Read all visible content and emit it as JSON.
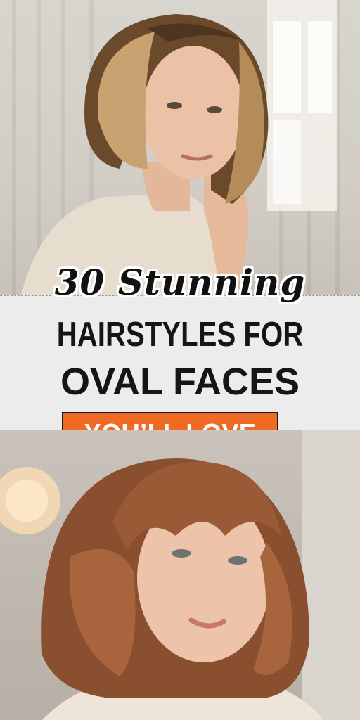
{
  "headline": {
    "script_text": "30 Stunning",
    "line1": "HAIRSTYLES FOR",
    "line2": "OVAL FACES"
  },
  "tag": {
    "label": "YOU’LL LOVE",
    "color": "#f06a23"
  },
  "photos": [
    {
      "subject": "woman with blonde-highlighted chin-length bob",
      "hair_color": "#6b4a2c"
    },
    {
      "subject": "woman with auburn layered bob and curtain bangs",
      "hair_color": "#9a5a35"
    }
  ]
}
